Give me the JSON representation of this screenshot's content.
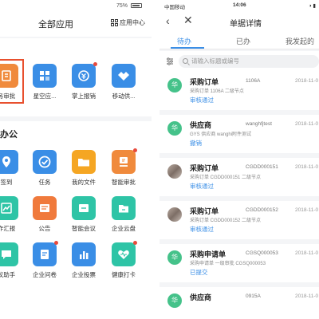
{
  "left": {
    "status": {
      "battery": "75%"
    },
    "header": {
      "title": "全部应用",
      "app_center": "应用中心"
    },
    "top_apps": [
      {
        "label": "务审批",
        "icon": "approval-icon",
        "color": "#f08a3c",
        "dot": false,
        "selected": true
      },
      {
        "label": "星空应...",
        "icon": "grid-app-icon",
        "color": "#3a8ee6",
        "dot": false,
        "selected": false
      },
      {
        "label": "掌上报销",
        "icon": "reimburse-icon",
        "color": "#3a8ee6",
        "dot": true,
        "selected": false
      },
      {
        "label": "移动供...",
        "icon": "handshake-icon",
        "color": "#3a8ee6",
        "dot": false,
        "selected": false
      }
    ],
    "office": {
      "title": "办公",
      "apps": [
        {
          "label": "签到",
          "icon": "location-icon",
          "color": "#3a8ee6",
          "dot": false
        },
        {
          "label": "任务",
          "icon": "check-circle-icon",
          "color": "#3a8ee6",
          "dot": false
        },
        {
          "label": "我的文件",
          "icon": "folder-icon",
          "color": "#f5a623",
          "dot": false
        },
        {
          "label": "智能审批",
          "icon": "stamp-icon",
          "color": "#f08a3c",
          "dot": true
        },
        {
          "label": "作汇报",
          "icon": "report-icon",
          "color": "#2ec4a6",
          "dot": false
        },
        {
          "label": "公告",
          "icon": "announcement-icon",
          "color": "#f07a3c",
          "dot": false
        },
        {
          "label": "智能会议",
          "icon": "meeting-icon",
          "color": "#2ec4a6",
          "dot": false
        },
        {
          "label": "企业云盘",
          "icon": "cloud-folder-icon",
          "color": "#2ec4a6",
          "dot": false
        },
        {
          "label": "议助手",
          "icon": "chat-icon",
          "color": "#2ec4a6",
          "dot": false
        },
        {
          "label": "企业问卷",
          "icon": "survey-icon",
          "color": "#3a8ee6",
          "dot": true
        },
        {
          "label": "企业投票",
          "icon": "vote-chart-icon",
          "color": "#3a8ee6",
          "dot": false
        },
        {
          "label": "健康打卡",
          "icon": "health-icon",
          "color": "#2ec4a6",
          "dot": true
        }
      ]
    }
  },
  "right": {
    "status": {
      "carrier": "中国移动",
      "time": "14:06",
      "icons": "◑ ▮"
    },
    "nav": {
      "back": "‹",
      "close": "✕",
      "title": "单据详情"
    },
    "tabs": [
      "待办",
      "已办",
      "我发起的"
    ],
    "search": {
      "placeholder": "请输入标题或编号"
    },
    "items": [
      {
        "avatar": "华",
        "avatar_type": "green",
        "title": "采购订单",
        "code": "1106A",
        "date": "2018-11-0",
        "sub": "采购订单 1106A 二级节点",
        "status": "审核通过"
      },
      {
        "avatar": "华",
        "avatar_type": "green",
        "title": "供应商",
        "code": "wanghfjtest",
        "date": "2018-11-0",
        "sub": "GYS 供应商 wanghi附件测试",
        "status": "撤销"
      },
      {
        "avatar": "",
        "avatar_type": "photo",
        "title": "采购订单",
        "code": "CGDD000151",
        "date": "2018-11-0",
        "sub": "采购订单 CGDD000151 二级节点",
        "status": "审核通过"
      },
      {
        "avatar": "",
        "avatar_type": "photo",
        "title": "采购订单",
        "code": "CGDD000152",
        "date": "2018-11-0",
        "sub": "采购订单 CGDD000152 二级节点",
        "status": "审核通过"
      },
      {
        "avatar": "华",
        "avatar_type": "green",
        "title": "采购申请单",
        "code": "CGSQ000053",
        "date": "2018-11-0",
        "sub": "采购申请单 一级审批 CGSQ000053",
        "status": "已提交"
      },
      {
        "avatar": "华",
        "avatar_type": "green",
        "title": "供应商",
        "code": "0915A",
        "date": "2018-11-0",
        "sub": "",
        "status": ""
      }
    ]
  }
}
